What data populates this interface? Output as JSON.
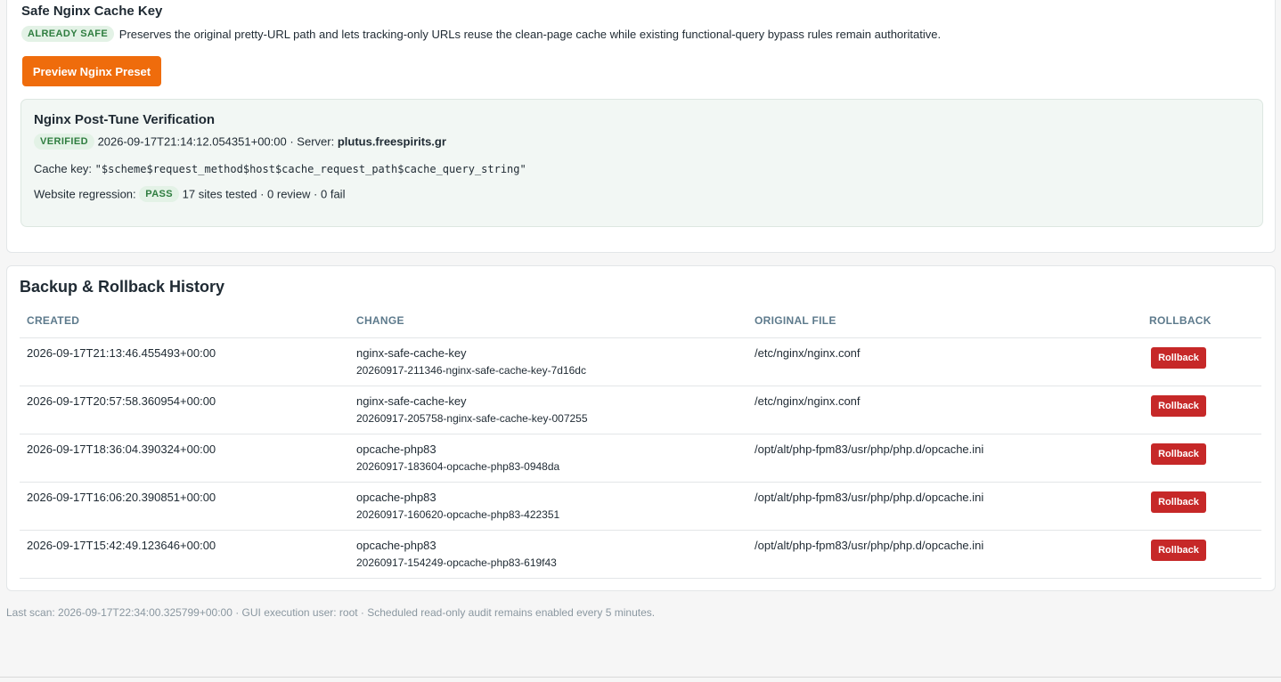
{
  "safe_cache_key": {
    "title": "Safe Nginx Cache Key",
    "badge": "ALREADY SAFE",
    "description": "Preserves the original pretty-URL path and lets tracking-only URLs reuse the clean-page cache while existing functional-query bypass rules remain authoritative.",
    "preview_button": "Preview Nginx Preset"
  },
  "verification": {
    "title": "Nginx Post-Tune Verification",
    "badge": "VERIFIED",
    "timestamp": "2026-09-17T21:14:12.054351+00:00",
    "server_label": "· Server:",
    "server": "plutus.freespirits.gr",
    "cache_key_label": "Cache key:",
    "cache_key": "\"$scheme$request_method$host$cache_request_path$cache_query_string\"",
    "regression_label": "Website regression:",
    "regression_badge": "PASS",
    "regression_summary": "17 sites tested · 0 review · 0 fail"
  },
  "history": {
    "title": "Backup & Rollback History",
    "columns": [
      "CREATED",
      "CHANGE",
      "ORIGINAL FILE",
      "ROLLBACK"
    ],
    "rows": [
      {
        "created": "2026-09-17T21:13:46.455493+00:00",
        "change": "nginx-safe-cache-key",
        "change_id": "20260917-211346-nginx-safe-cache-key-7d16dc",
        "file": "/etc/nginx/nginx.conf",
        "action": "Rollback"
      },
      {
        "created": "2026-09-17T20:57:58.360954+00:00",
        "change": "nginx-safe-cache-key",
        "change_id": "20260917-205758-nginx-safe-cache-key-007255",
        "file": "/etc/nginx/nginx.conf",
        "action": "Rollback"
      },
      {
        "created": "2026-09-17T18:36:04.390324+00:00",
        "change": "opcache-php83",
        "change_id": "20260917-183604-opcache-php83-0948da",
        "file": "/opt/alt/php-fpm83/usr/php/php.d/opcache.ini",
        "action": "Rollback"
      },
      {
        "created": "2026-09-17T16:06:20.390851+00:00",
        "change": "opcache-php83",
        "change_id": "20260917-160620-opcache-php83-422351",
        "file": "/opt/alt/php-fpm83/usr/php/php.d/opcache.ini",
        "action": "Rollback"
      },
      {
        "created": "2026-09-17T15:42:49.123646+00:00",
        "change": "opcache-php83",
        "change_id": "20260917-154249-opcache-php83-619f43",
        "file": "/opt/alt/php-fpm83/usr/php/php.d/opcache.ini",
        "action": "Rollback"
      }
    ]
  },
  "footer": {
    "text": "Last scan: 2026-09-17T22:34:00.325799+00:00 · GUI execution user: root · Scheduled read-only audit remains enabled every 5 minutes."
  },
  "colors": {
    "accent_orange": "#ef6c0c",
    "danger_red": "#c62828",
    "success_green": "#2e7d3f",
    "success_bg": "#e3f2e6"
  }
}
